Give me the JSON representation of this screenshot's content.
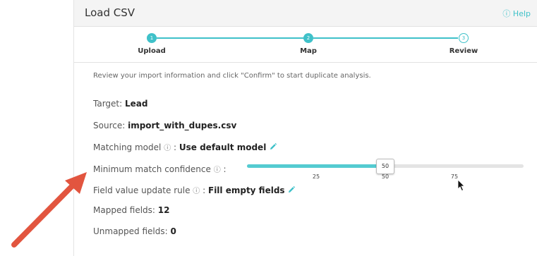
{
  "header": {
    "title": "Load CSV",
    "help_label": "ⓘ Help"
  },
  "stepper": {
    "steps": [
      {
        "number": "1",
        "label": "Upload"
      },
      {
        "number": "2",
        "label": "Map"
      },
      {
        "number": "3",
        "label": "Review"
      }
    ]
  },
  "intro": "Review your import information and click \"Confirm\" to start duplicate analysis.",
  "target": {
    "label": "Target:",
    "value": "Lead"
  },
  "source": {
    "label": "Source:",
    "value": "import_with_dupes.csv"
  },
  "matching_model": {
    "label": "Matching model",
    "info": "ⓘ",
    "sep": ":",
    "value": "Use default model"
  },
  "min_confidence": {
    "label": "Minimum match confidence",
    "info": "ⓘ",
    "sep": ":",
    "value": "50",
    "value_number": 50,
    "min": 0,
    "max": 100,
    "ticks": [
      "25",
      "50",
      "75"
    ]
  },
  "field_update": {
    "label": "Field value update rule",
    "info": "ⓘ",
    "sep": ":",
    "value": "Fill empty fields"
  },
  "mapped": {
    "label": "Mapped fields:",
    "value": "12"
  },
  "unmapped": {
    "label": "Unmapped fields:",
    "value": "0"
  },
  "colors": {
    "accent": "#3fc1c9",
    "arrow": "#e2553f"
  }
}
